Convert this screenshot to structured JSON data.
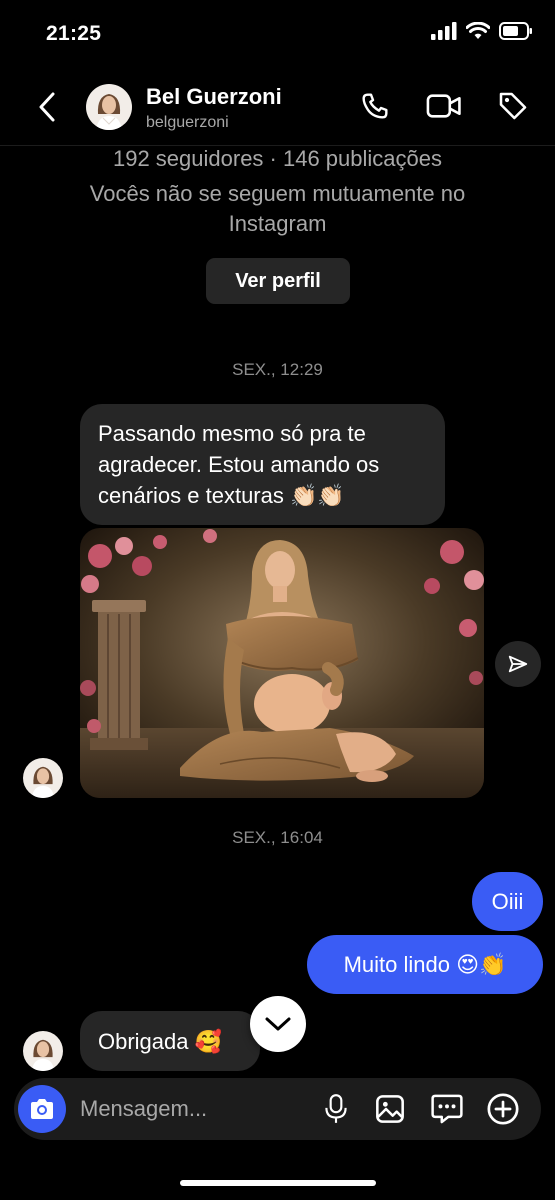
{
  "status_bar": {
    "time": "21:25"
  },
  "header": {
    "name": "Bel Guerzoni",
    "username": "belguerzoni"
  },
  "profile": {
    "stats": "192 seguidores · 146 publicações",
    "mutual_line1": "Vocês não se seguem mutuamente no",
    "mutual_line2": "Instagram",
    "view_profile_label": "Ver perfil"
  },
  "messages": {
    "date1": "SEX., 12:29",
    "msg1_line1": "Passando mesmo só pra te",
    "msg1_line2": "agradecer. Estou amando os",
    "msg1_line3": "cenários e texturas 👏🏻👏🏻",
    "date2": "SEX., 16:04",
    "out1": "Oiii",
    "out2": "Muito lindo 😍👏",
    "in2": "Obrigada 🥰"
  },
  "composer": {
    "placeholder": "Mensagem..."
  },
  "colors": {
    "accent": "#3a5cf5",
    "bubble_in": "#262626",
    "background": "#000000"
  },
  "icons": [
    "back-icon",
    "phone-icon",
    "video-icon",
    "tag-icon",
    "share-icon",
    "chevron-down-icon",
    "camera-icon",
    "microphone-icon",
    "gallery-icon",
    "sticker-icon",
    "plus-icon"
  ]
}
